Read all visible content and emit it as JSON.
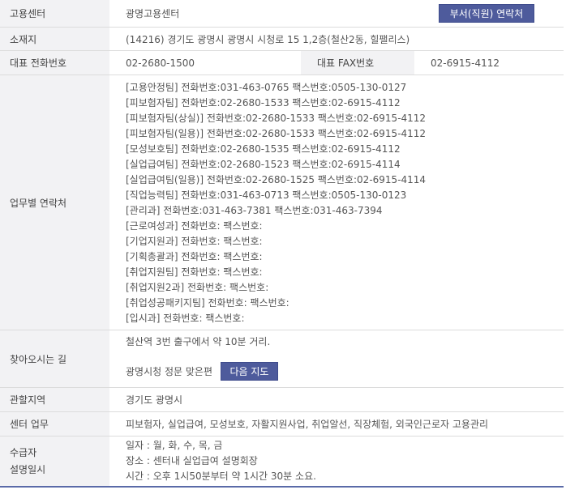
{
  "center": {
    "label": "고용센터",
    "value": "광명고용센터",
    "contact_button": "부서(직원) 연락처"
  },
  "location": {
    "label": "소재지",
    "value": "(14216) 경기도 광명시 광명시 시청로 15 1,2층(철산2동, 힐팰리스)"
  },
  "phone": {
    "label": "대표 전화번호",
    "value": "02-2680-1500",
    "fax_label": "대표 FAX번호",
    "fax_value": "02-6915-4112"
  },
  "contacts": {
    "label": "업무별 연락처",
    "lines": [
      "[고용안정팀] 전화번호:031-463-0765 팩스번호:0505-130-0127",
      "[피보험자팀] 전화번호:02-2680-1533 팩스번호:02-6915-4112",
      "[피보험자팀(상실)] 전화번호:02-2680-1533 팩스번호:02-6915-4112",
      "[피보험자팀(일용)] 전화번호:02-2680-1533 팩스번호:02-6915-4112",
      "[모성보호팀] 전화번호:02-2680-1535 팩스번호:02-6915-4112",
      "[실업급여팀] 전화번호:02-2680-1523 팩스번호:02-6915-4114",
      "[실업급여팀(일용)] 전화번호:02-2680-1525 팩스번호:02-6915-4114",
      "[직업능력팀] 전화번호:031-463-0713 팩스번호:0505-130-0123",
      "[관리과] 전화번호:031-463-7381 팩스번호:031-463-7394",
      "[근로여성과] 전화번호: 팩스번호:",
      "[기업지원과] 전화번호: 팩스번호:",
      "[기획총괄과] 전화번호: 팩스번호:",
      "[취업지원팀] 전화번호: 팩스번호:",
      "[취업지원2과] 전화번호: 팩스번호:",
      "[취업성공패키지팀] 전화번호: 팩스번호:",
      "[입시과] 전화번호: 팩스번호:"
    ]
  },
  "directions": {
    "label": "찾아오시는 길",
    "text": "철산역 3번 출구에서 약 10분 거리.",
    "landmark": "광명시청 정문 맞은편",
    "map_button": "다음 지도"
  },
  "jurisdiction": {
    "label": "관할지역",
    "value": "경기도 광명시"
  },
  "services": {
    "label": "센터 업무",
    "value": "피보험자, 실업급여, 모성보호, 자활지원사업, 취업알선, 직장체험, 외국인근로자 고용관리"
  },
  "schedule": {
    "label_line1": "수급자",
    "label_line2": "설명일시",
    "days": "일자 : 월, 화, 수, 목, 금",
    "place": "장소 : 센터내 실업급여 설명회장",
    "time": "시간 : 오후 1시50분부터 약 1시간 30분 소요."
  }
}
